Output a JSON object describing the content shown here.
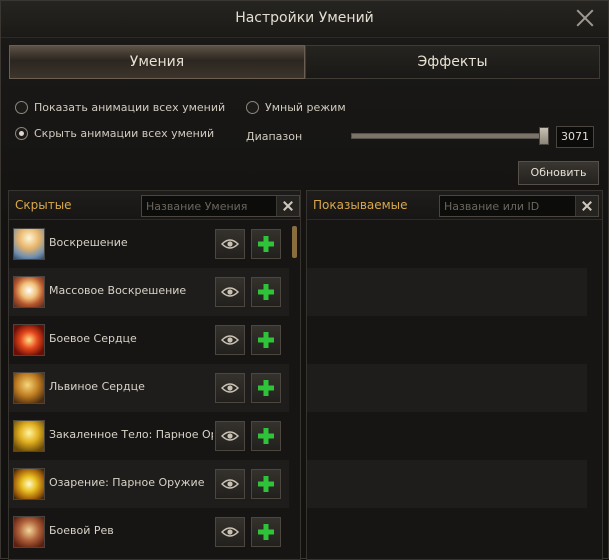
{
  "window": {
    "title": "Настройки Умений"
  },
  "tabs": [
    {
      "label": "Умения",
      "active": true
    },
    {
      "label": "Эффекты",
      "active": false
    }
  ],
  "options": {
    "show_all": {
      "label": "Показать анимации всех умений",
      "checked": false
    },
    "hide_all": {
      "label": "Скрыть анимации всех умений",
      "checked": true
    },
    "smart_mode": {
      "label": "Умный режим",
      "checked": false
    }
  },
  "range": {
    "label": "Диапазон",
    "value": "3071",
    "fraction": 0.98
  },
  "refresh_label": "Обновить",
  "hidden_panel": {
    "title": "Скрытые",
    "search_placeholder": "Название Умения",
    "skills": [
      {
        "name": "Воскрешение",
        "icon": "resurrection-icon"
      },
      {
        "name": "Массовое Воскрешение",
        "icon": "mass-resurrection-icon"
      },
      {
        "name": "Боевое Сердце",
        "icon": "battle-heart-icon"
      },
      {
        "name": "Львиное Сердце",
        "icon": "lion-heart-icon"
      },
      {
        "name": "Закаленное Тело: Парное Оруж",
        "icon": "tempered-body-icon"
      },
      {
        "name": "Озарение: Парное Оружие",
        "icon": "enlightenment-icon"
      },
      {
        "name": "Боевой Рев",
        "icon": "battle-roar-icon"
      }
    ]
  },
  "shown_panel": {
    "title": "Показываемые",
    "search_placeholder": "Название или ID"
  },
  "colors": {
    "accent": "#d9a84a",
    "add_green": "#2fc33a"
  }
}
